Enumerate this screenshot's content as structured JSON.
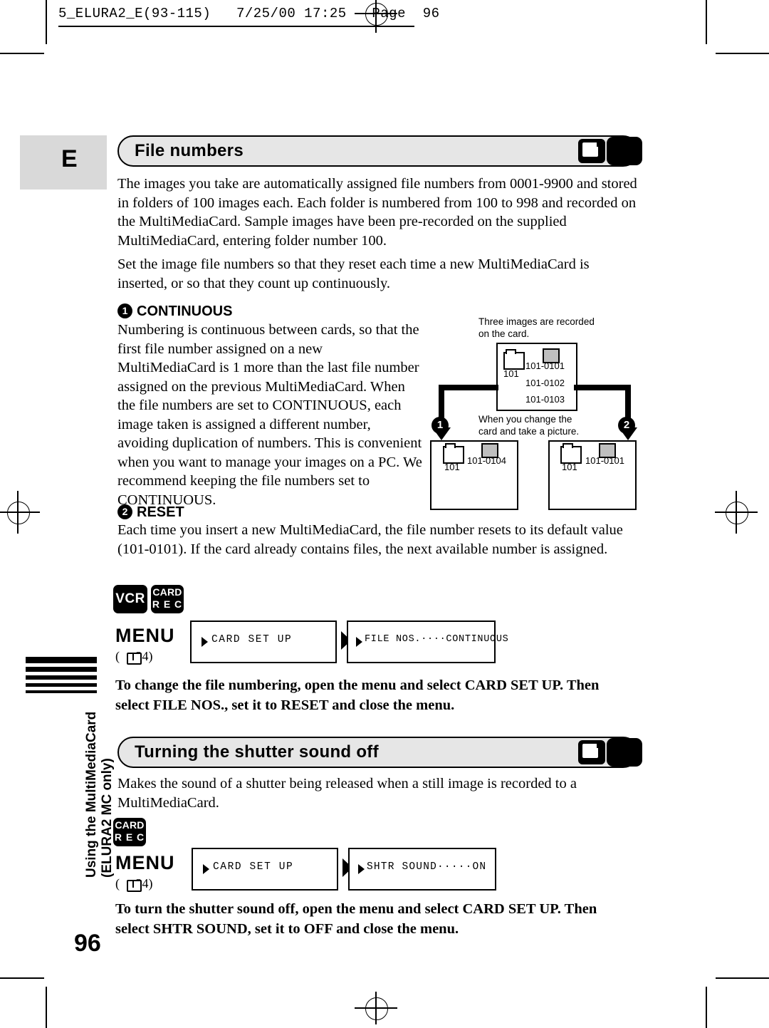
{
  "header": {
    "text": "5_ELURA2_E(93-115)   7/25/00 17:25   Page  96"
  },
  "side_tab": {
    "letter": "E",
    "vertical_line1": "Using the MultiMediaCard",
    "vertical_line2": "(ELURA2 MC only)"
  },
  "page_number": "96",
  "sections": [
    {
      "title": "File numbers",
      "intro1": "The images you take are automatically assigned file numbers from 0001-9900 and stored in folders of 100 images each. Each folder is numbered from 100 to 998 and recorded on the MultiMediaCard. Sample images have been pre-recorded on the supplied MultiMediaCard, entering folder number 100.",
      "intro2": "Set the image file numbers so that they reset each time a new MultiMediaCard is inserted, or so that they count up continuously."
    }
  ],
  "item1": {
    "number": "1",
    "heading": "CONTINUOUS",
    "body": "Numbering is continuous between cards, so that the first file number assigned on a new MultiMediaCard is 1 more than the last file number assigned on the previous MultiMediaCard. When the file numbers are set to CONTINUOUS, each image taken is assigned a different number, avoiding duplication of numbers. This is convenient when you want to manage your images on a PC. We recommend keeping the file numbers set to CONTINUOUS."
  },
  "item2": {
    "number": "2",
    "heading": "RESET",
    "body": "Each time you insert a new MultiMediaCard, the file number resets to its default value (101-0101). If the card already contains files, the next available number is assigned."
  },
  "diagram": {
    "caption_top": "Three images are recorded on the card.",
    "caption_mid": "When you change the card and take a picture.",
    "marker_left": "1",
    "marker_right": "2",
    "card_top": {
      "folder": "101",
      "files": [
        "101-0101",
        "101-0102",
        "101-0103"
      ]
    },
    "card_left": {
      "folder": "101",
      "files": [
        "101-0104"
      ]
    },
    "card_right": {
      "folder": "101",
      "files": [
        "101-0101"
      ]
    }
  },
  "menu_flow_1": {
    "mode_icons": [
      "VCR",
      "CARD REC"
    ],
    "vcr_label": "VCR",
    "card_label_1": "CARD",
    "card_label_2": "R E C",
    "menu_label": "MENU",
    "page_ref": "34",
    "box1": "CARD SET UP",
    "box2": "FILE NOS.····CONTINUOUS",
    "instruction": "To change the file numbering, open the menu and select CARD SET UP. Then select FILE NOS., set it to RESET and close the menu."
  },
  "section2": {
    "title": "Turning the shutter sound off",
    "body": "Makes the sound of a shutter being released when a still image is recorded to a MultiMediaCard."
  },
  "menu_flow_2": {
    "card_label_1": "CARD",
    "card_label_2": "R E C",
    "menu_label": "MENU",
    "page_ref": "34",
    "box1": "CARD SET UP",
    "box2": "SHTR SOUND·····ON",
    "instruction": "To turn the shutter sound off, open the menu and select CARD SET UP. Then select SHTR SOUND, set it to OFF and close the menu."
  }
}
